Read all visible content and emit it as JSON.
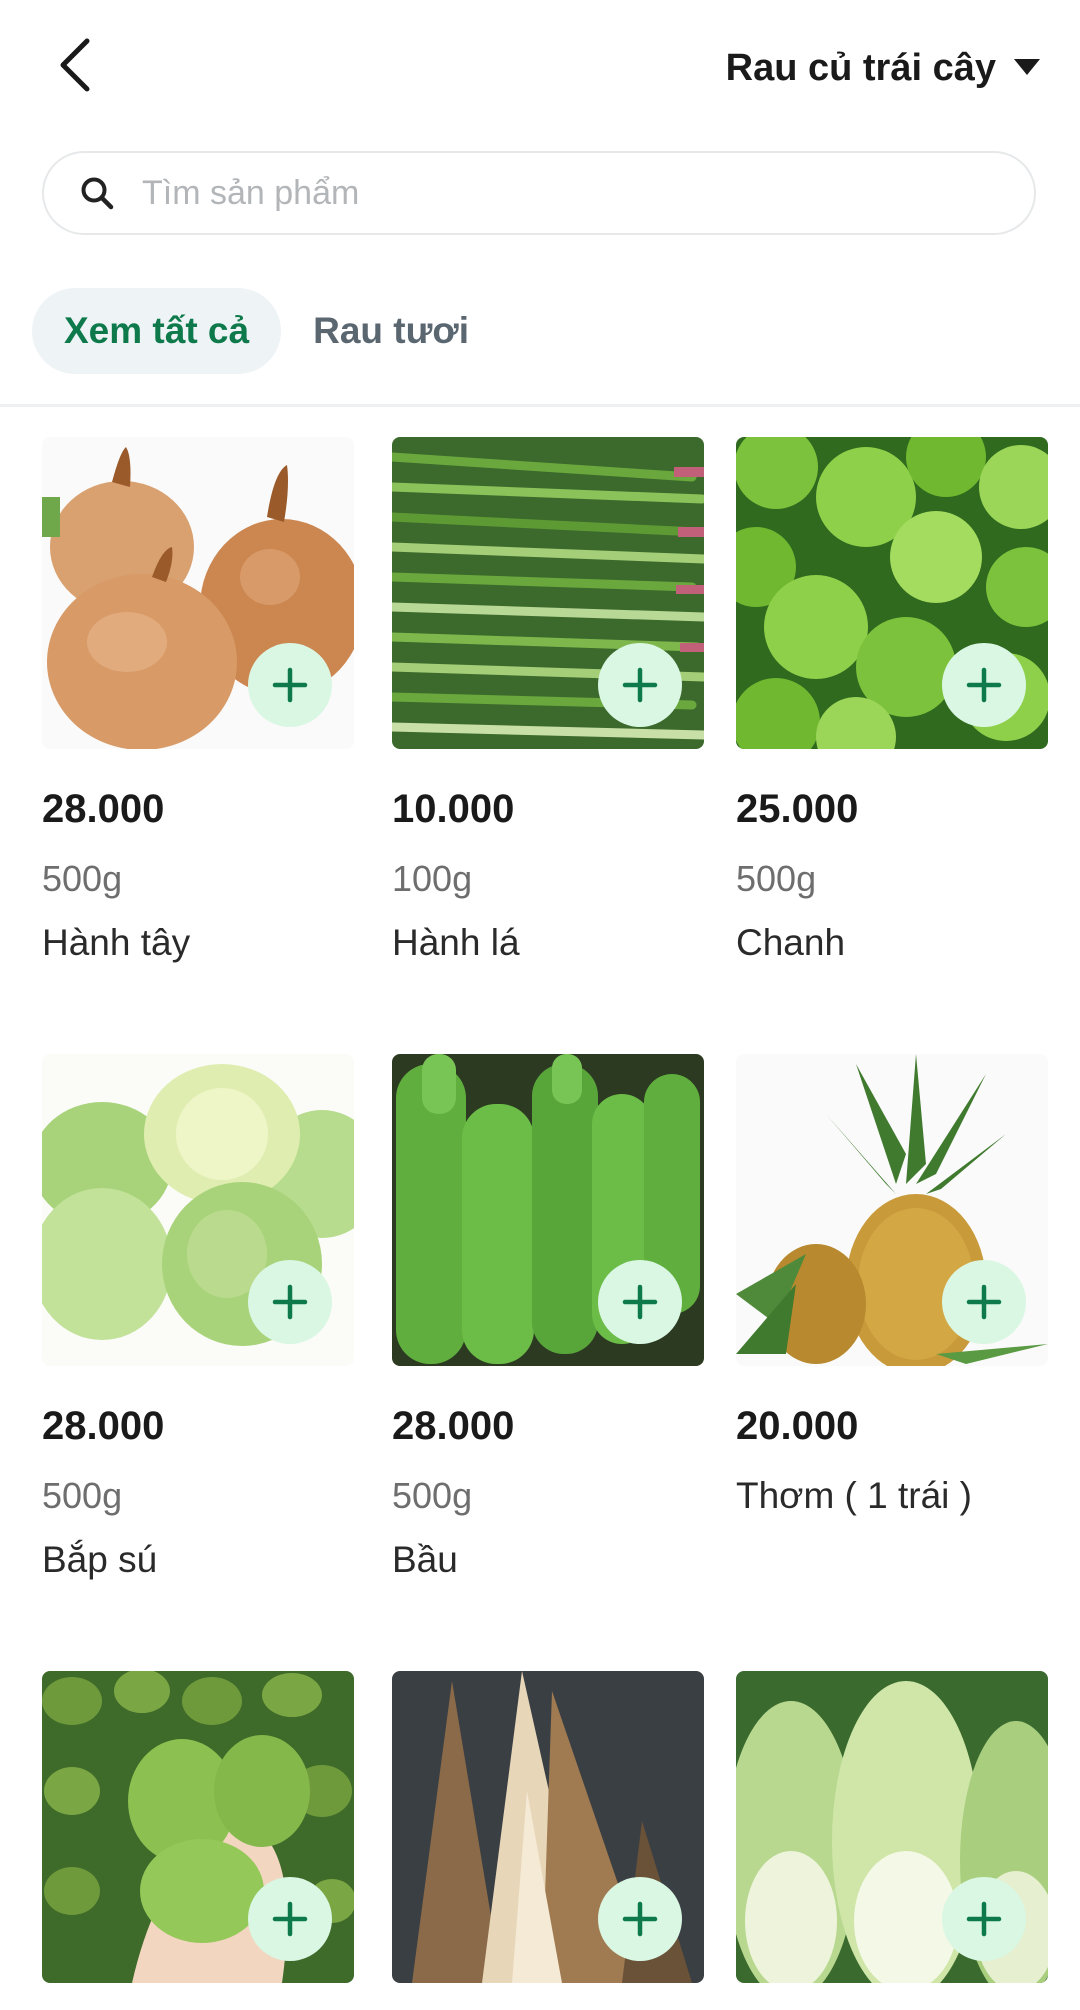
{
  "header": {
    "back_icon": "chevron-left-icon",
    "category": "Rau củ trái cây",
    "dropdown_icon": "caret-down-icon"
  },
  "search": {
    "placeholder": "Tìm sản phẩm",
    "value": "",
    "icon": "search-icon"
  },
  "tabs": [
    {
      "label": "Xem tất cả",
      "active": true
    },
    {
      "label": "Rau tươi",
      "active": false
    }
  ],
  "colors": {
    "accent": "#0e7a4c",
    "add_button_bg": "#d9f7e3",
    "tab_active_bg": "#eef3f6"
  },
  "products": [
    {
      "price": "28.000",
      "unit": "500g",
      "name": "Hành tây",
      "image": "onion"
    },
    {
      "price": "10.000",
      "unit": "100g",
      "name": "Hành lá",
      "image": "green-onion"
    },
    {
      "price": "25.000",
      "unit": "500g",
      "name": "Chanh",
      "image": "lime"
    },
    {
      "price": "28.000",
      "unit": "500g",
      "name": "Bắp sú",
      "image": "cabbage"
    },
    {
      "price": "28.000",
      "unit": "500g",
      "name": "Bầu",
      "image": "gourd"
    },
    {
      "price": "20.000",
      "unit": "Thơm ( 1 trái )",
      "name": "",
      "image": "pineapple"
    },
    {
      "price": "",
      "unit": "",
      "name": "",
      "image": "avocado"
    },
    {
      "price": "",
      "unit": "",
      "name": "",
      "image": "bamboo-shoot"
    },
    {
      "price": "",
      "unit": "",
      "name": "",
      "image": "napa-cabbage"
    }
  ]
}
